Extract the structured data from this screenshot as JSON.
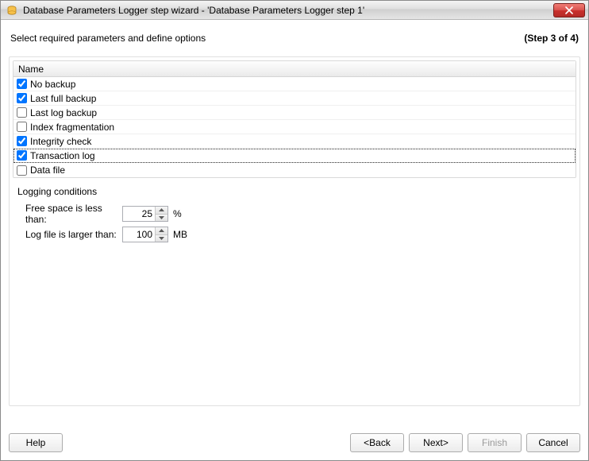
{
  "window": {
    "title": "Database Parameters Logger step wizard - 'Database Parameters Logger step 1'"
  },
  "header": {
    "subtitle": "Select required parameters and define options",
    "step": "(Step 3 of 4)"
  },
  "list": {
    "column_header": "Name",
    "items": [
      {
        "label": "No backup",
        "checked": true
      },
      {
        "label": "Last full backup",
        "checked": true
      },
      {
        "label": "Last log backup",
        "checked": false
      },
      {
        "label": "Index fragmentation",
        "checked": false
      },
      {
        "label": "Integrity check",
        "checked": true
      },
      {
        "label": "Transaction log",
        "checked": true,
        "focused": true
      },
      {
        "label": "Data file",
        "checked": false
      }
    ]
  },
  "conditions": {
    "title": "Logging conditions",
    "free_space": {
      "label": "Free space is less than:",
      "value": "25",
      "unit": "%"
    },
    "log_file": {
      "label": "Log file is larger than:",
      "value": "100",
      "unit": "MB"
    }
  },
  "buttons": {
    "help": "Help",
    "back": "<Back",
    "next": "Next>",
    "finish": "Finish",
    "cancel": "Cancel"
  }
}
